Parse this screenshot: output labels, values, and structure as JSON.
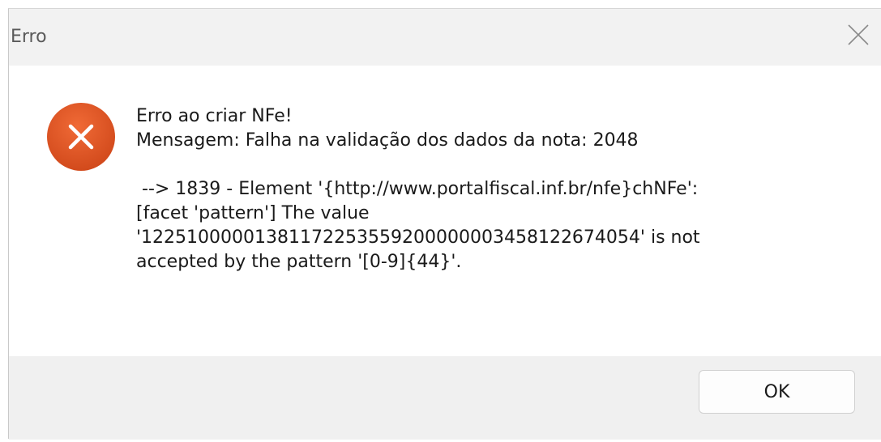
{
  "window": {
    "title": "Erro",
    "close_icon": "close-icon"
  },
  "dialog": {
    "icon": "error-icon",
    "icon_color": "#e05a2b",
    "message": "Erro ao criar NFe!\nMensagem: Falha na validação dos dados da nota: 2048\n\n --> 1839 - Element '{http://www.portalfiscal.inf.br/nfe}chNFe':\n[facet 'pattern'] The value\n'12251000001381172253559200000003458122674054' is not\naccepted by the pattern '[0-9]{44}'."
  },
  "buttons": {
    "ok_label": "OK"
  }
}
